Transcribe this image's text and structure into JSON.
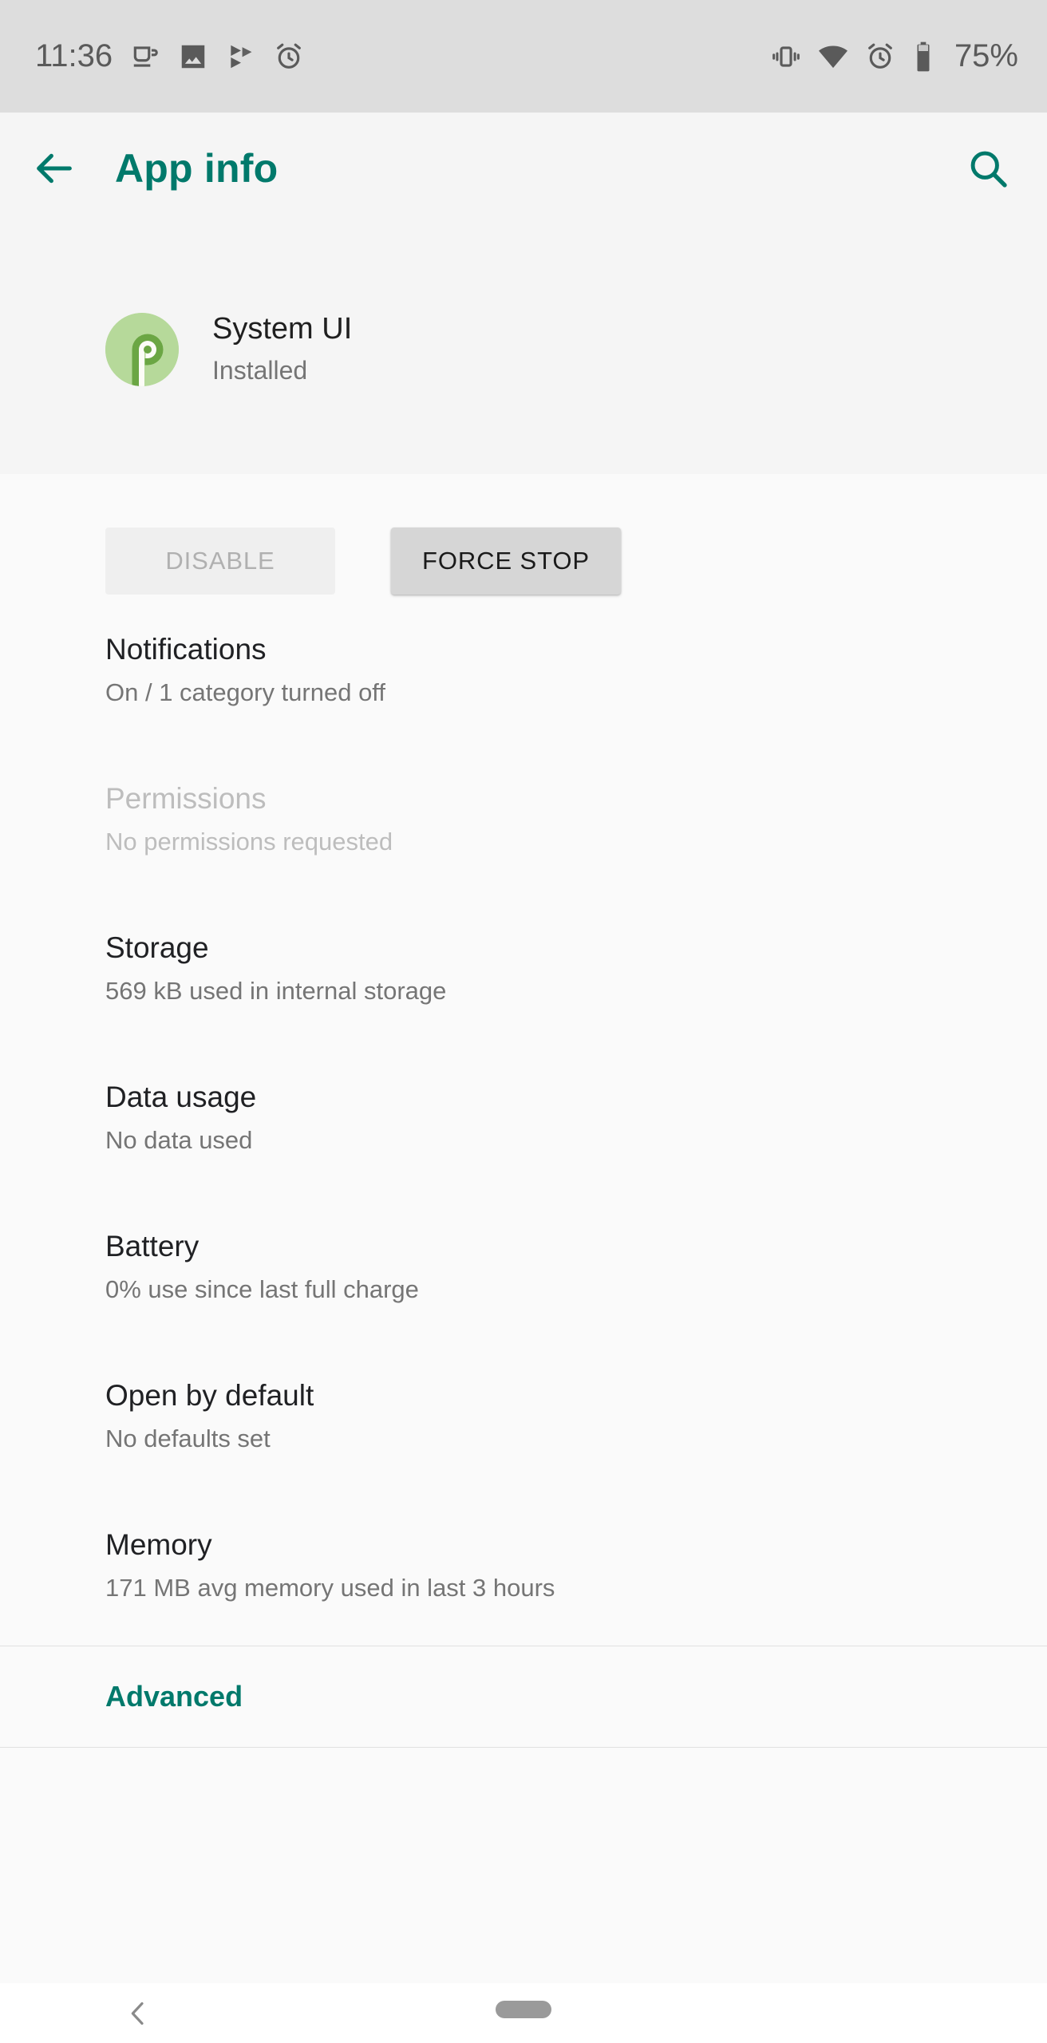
{
  "status_bar": {
    "time": "11:36",
    "battery_percent": "75%",
    "left_icons": [
      "coffee-cup-icon",
      "image-icon",
      "play-protect-icon",
      "alarm-clock-icon"
    ],
    "right_icons": [
      "vibrate-icon",
      "wifi-icon",
      "alarm-clock-icon",
      "battery-icon"
    ],
    "background": "#DDDDDD"
  },
  "action_bar": {
    "title": "App info",
    "back_icon": "arrow-left-icon",
    "search_icon": "search-icon",
    "accent_color": "#00796B"
  },
  "app_header": {
    "name": "System UI",
    "status": "Installed",
    "icon": "android-pie-logo",
    "icon_bg": "#B6D99A",
    "icon_fg": "#6BA644"
  },
  "buttons": {
    "disable": {
      "label": "DISABLE",
      "enabled": false
    },
    "force_stop": {
      "label": "FORCE STOP",
      "enabled": true
    }
  },
  "settings_rows": [
    {
      "title": "Notifications",
      "summary": "On / 1 category turned off",
      "enabled": true
    },
    {
      "title": "Permissions",
      "summary": "No permissions requested",
      "enabled": false
    },
    {
      "title": "Storage",
      "summary": "569 kB used in internal storage",
      "enabled": true
    },
    {
      "title": "Data usage",
      "summary": "No data used",
      "enabled": true
    },
    {
      "title": "Battery",
      "summary": "0% use since last full charge",
      "enabled": true
    },
    {
      "title": "Open by default",
      "summary": "No defaults set",
      "enabled": true
    },
    {
      "title": "Memory",
      "summary": "171 MB avg memory used in last 3 hours",
      "enabled": true
    }
  ],
  "advanced": {
    "label": "Advanced"
  },
  "nav_bar": {
    "back_icon": "chevron-left-icon",
    "home_pill": "home-pill-handle"
  }
}
